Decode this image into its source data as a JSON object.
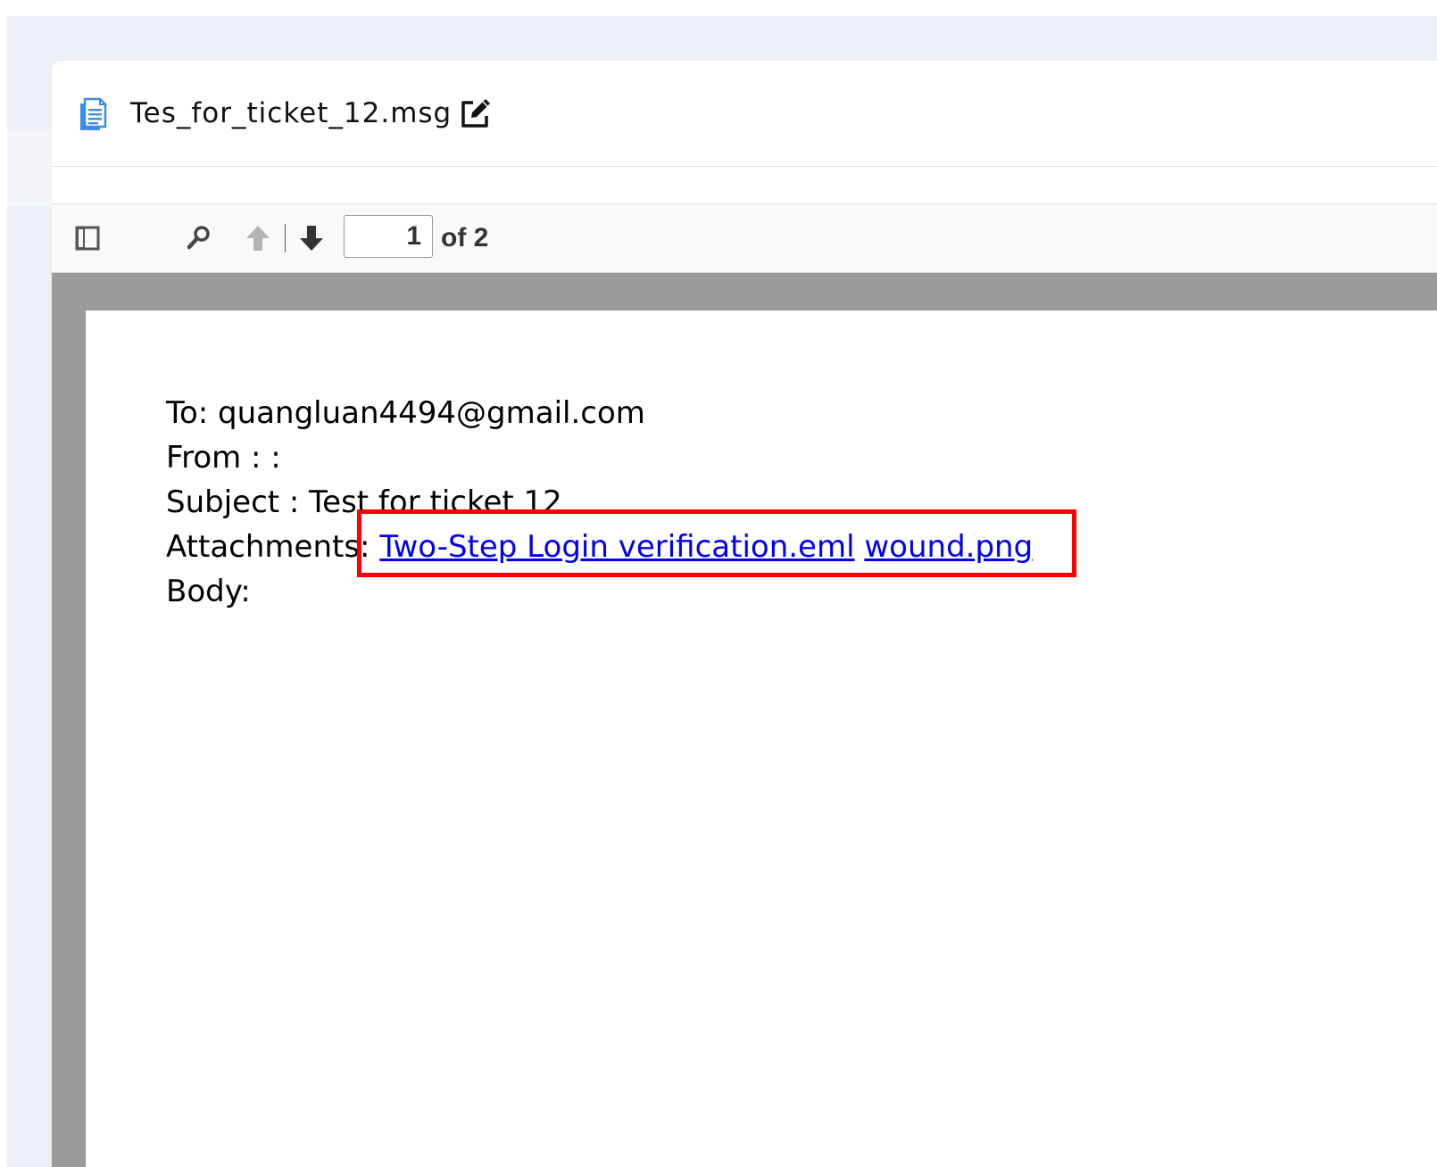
{
  "document": {
    "file_name": "Tes_for_ticket_12.msg"
  },
  "viewer": {
    "current_page": "1",
    "page_count_label": "of 2"
  },
  "email": {
    "to_line": "To: quangluan4494@gmail.com",
    "from_line": "From : :",
    "subject_line": "Subject : Test for ticket 12",
    "attachments_label": "Attachments:",
    "attachments": [
      "Two-Step Login verification.eml",
      "wound.png"
    ],
    "body_label": "Body:"
  },
  "colors": {
    "link": "#0000ee",
    "highlight": "#ff0000",
    "icon_blue": "#3a8ee6",
    "viewer_bg": "#9b9b9b"
  }
}
